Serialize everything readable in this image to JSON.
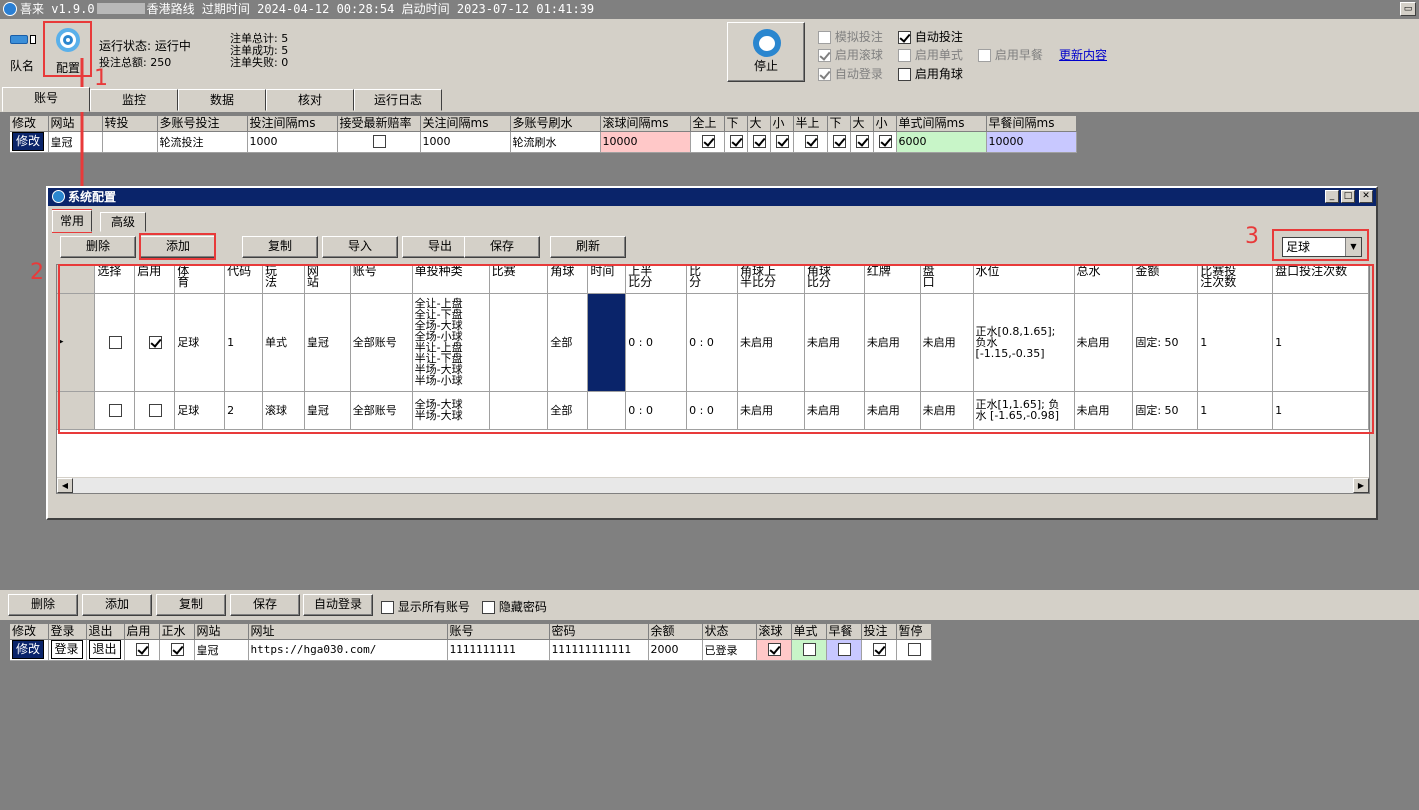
{
  "titlebar": {
    "app": "喜来",
    "version": "v1.9.0",
    "route": "香港路线",
    "expire_label": "过期时间",
    "expire_time": "2024-04-12 00:28:54",
    "start_label": "启动时间",
    "start_time": "2023-07-12 01:41:39",
    "restore_glyph": "▭"
  },
  "toolbar": {
    "team_label": "队名",
    "config_label": "配置",
    "status_line1": "运行状态: 运行中",
    "status_line2": "投注总额: 250",
    "stat1": "注单总计: 5",
    "stat2": "注单成功: 5",
    "stat3": "注单失败: 0",
    "stop_label": "停止",
    "options": {
      "simulate": "模拟投注",
      "auto_bet": "自动投注",
      "enable_rolling": "启用滚球",
      "enable_single": "启用单式",
      "enable_early": "启用早餐",
      "auto_login": "自动登录",
      "enable_corner": "启用角球"
    },
    "update_link": "更新内容"
  },
  "tabs": [
    "账号",
    "监控",
    "数据",
    "核对",
    "运行日志"
  ],
  "account_grid": {
    "headers": [
      "修改",
      "网站",
      "转投",
      "多账号投注",
      "投注间隔ms",
      "接受最新赔率",
      "关注间隔ms",
      "多账号刷水",
      "滚球间隔ms",
      "全上",
      "下",
      "大",
      "小",
      "半上",
      "下",
      "大",
      "小",
      "单式间隔ms",
      "早餐间隔ms"
    ],
    "row": {
      "edit": "修改",
      "site": "皇冠",
      "multi_bet": "轮流投注",
      "bet_interval": "1000",
      "watch_interval": "1000",
      "multi_refresh": "轮流刷水",
      "rolling_interval": "10000",
      "single_interval": "6000",
      "early_interval": "10000"
    }
  },
  "dialog": {
    "title": "系统配置",
    "tabs": [
      "常用",
      "高级"
    ],
    "buttons": {
      "delete": "删除",
      "add": "添加",
      "copy": "复制",
      "import": "导入",
      "export": "导出",
      "save": "保存",
      "refresh": "刷新"
    },
    "sport_select": "足球",
    "headers": {
      "select": "选择",
      "enable": "启用",
      "sport": "体育",
      "code": "代码",
      "play": "玩法",
      "site": "网站",
      "account": "账号",
      "bet_type": "单投种类",
      "match": "比赛",
      "corner": "角球",
      "time": "时间",
      "half_score": "上半比分",
      "score": "比分",
      "corner_half": "角球上半比分",
      "corner_score": "角球比分",
      "red_card": "红牌",
      "handicap": "盘口",
      "water": "水位",
      "total_water": "总水",
      "amount": "金额",
      "match_bets": "比赛投注次数",
      "handicap_bets": "盘口投注次数"
    },
    "rows": [
      {
        "sport": "足球",
        "code": "1",
        "play": "单式",
        "site": "皇冠",
        "account": "全部账号",
        "bet_type": "全让-上盘 全让-下盘 全场-大球 全场-小球 半让-上盘 半让-下盘 半场-大球 半场-小球",
        "corner": "全部",
        "half_score": "0 : 0",
        "score": "0 : 0",
        "corner_half": "未启用",
        "corner_score": "未启用",
        "red_card": "未启用",
        "handicap": "未启用",
        "water": "正水[0.8,1.65]; 负水 [-1.15,-0.35]",
        "total_water": "未启用",
        "amount": "固定: 50",
        "match_bets": "1",
        "handicap_bets": "1"
      },
      {
        "sport": "足球",
        "code": "2",
        "play": "滚球",
        "site": "皇冠",
        "account": "全部账号",
        "bet_type": "全场-大球 半场-大球",
        "corner": "全部",
        "half_score": "0 : 0",
        "score": "0 : 0",
        "corner_half": "未启用",
        "corner_score": "未启用",
        "red_card": "未启用",
        "handicap": "未启用",
        "water": "正水[1,1.65]; 负水 [-1.65,-0.98]",
        "total_water": "未启用",
        "amount": "固定: 50",
        "match_bets": "1",
        "handicap_bets": "1"
      }
    ]
  },
  "annotations": [
    "1",
    "2",
    "3"
  ],
  "bottom_toolbar": {
    "delete": "删除",
    "add": "添加",
    "copy": "复制",
    "save": "保存",
    "auto_login": "自动登录",
    "show_all": "显示所有账号",
    "hide_pwd": "隐藏密码"
  },
  "login_grid": {
    "headers": [
      "修改",
      "登录",
      "退出",
      "启用",
      "正水",
      "网站",
      "网址",
      "账号",
      "密码",
      "余额",
      "状态",
      "滚球",
      "单式",
      "早餐",
      "投注",
      "暂停"
    ],
    "row": {
      "edit": "修改",
      "login": "登录",
      "logout": "退出",
      "site": "皇冠",
      "url": "https://hga030.com/",
      "account": "1111111111",
      "password": "111111111111",
      "balance": "2000",
      "status": "已登录"
    }
  },
  "colors": {
    "rolling_bg": "#ffc8c8",
    "single_bg": "#c8f5c8",
    "early_bg": "#c8c8ff",
    "selected_cell": "#0a246a",
    "annotation": "#e83a3a"
  }
}
